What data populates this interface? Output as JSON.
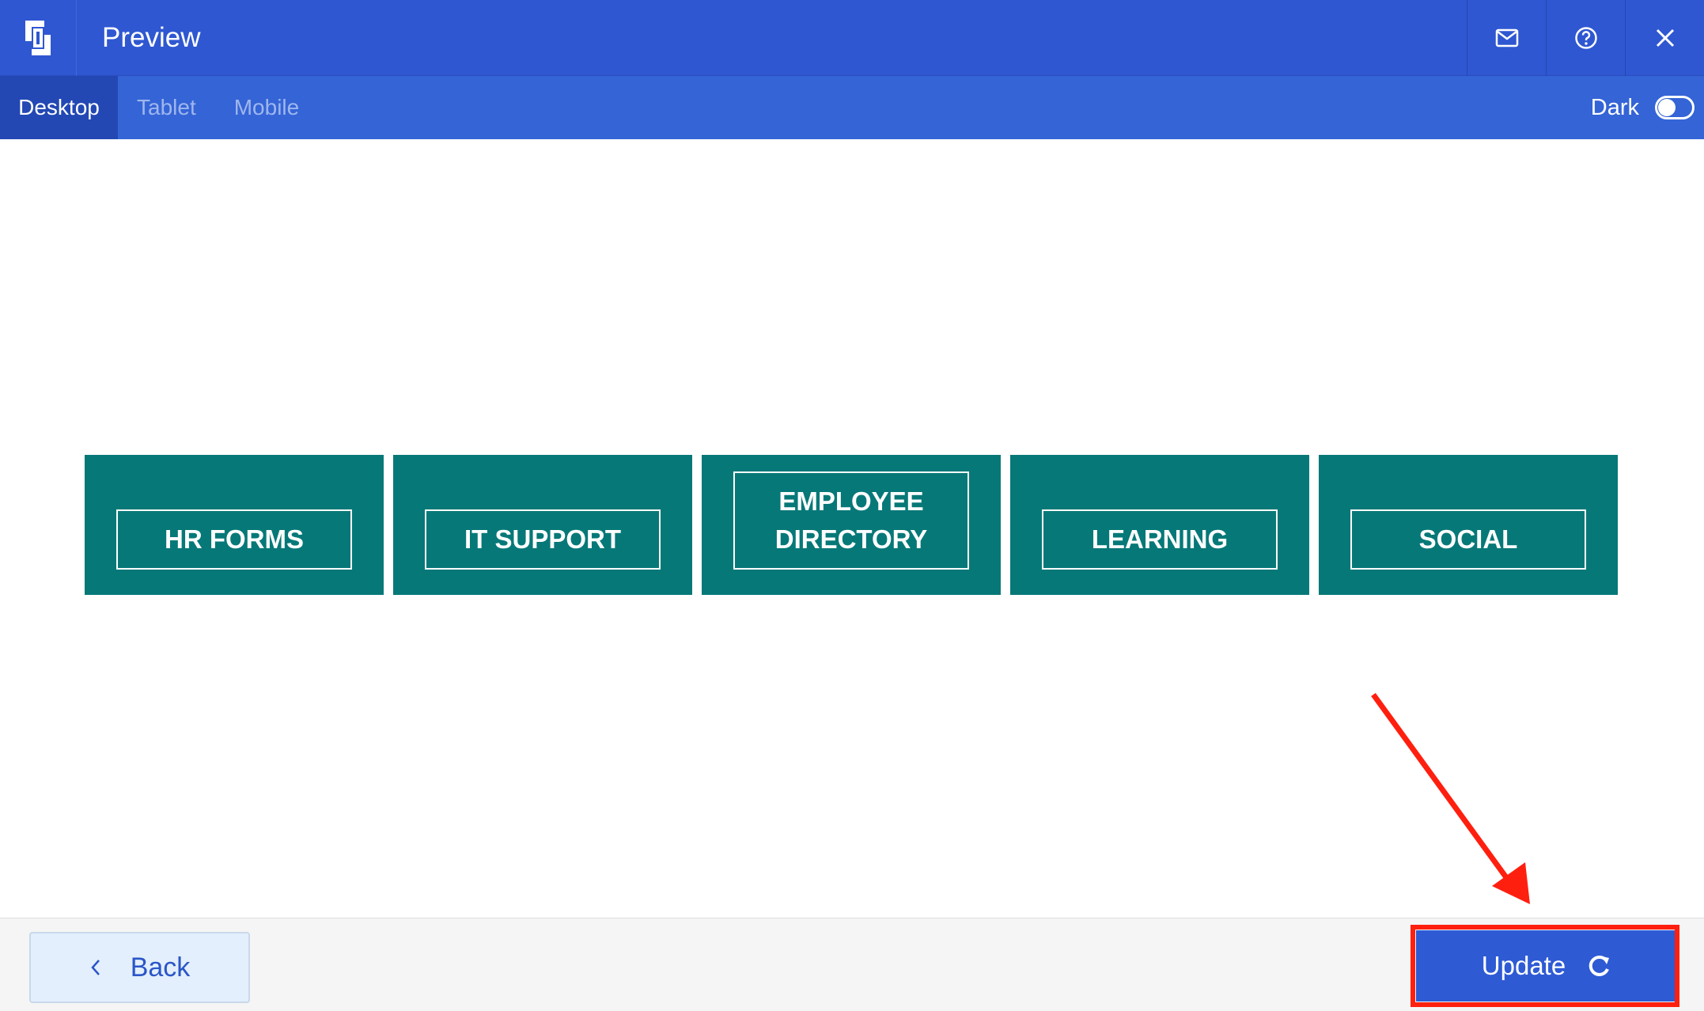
{
  "header": {
    "title": "Preview",
    "logo_icon": "brand-logo-icon",
    "actions": [
      {
        "name": "mail-icon"
      },
      {
        "name": "help-icon"
      },
      {
        "name": "close-icon"
      }
    ],
    "color": "#2f57d1"
  },
  "device_tabs": [
    {
      "label": "Desktop",
      "active": true
    },
    {
      "label": "Tablet",
      "active": false
    },
    {
      "label": "Mobile",
      "active": false
    }
  ],
  "dark_mode": {
    "label": "Dark",
    "enabled": false
  },
  "tiles": [
    {
      "label": "HR FORMS"
    },
    {
      "label": "IT SUPPORT"
    },
    {
      "label": "EMPLOYEE DIRECTORY"
    },
    {
      "label": "LEARNING"
    },
    {
      "label": "SOCIAL"
    }
  ],
  "tile_color": "#077878",
  "footer": {
    "back_label": "Back",
    "update_label": "Update",
    "update_icon": "refresh-icon",
    "back_icon": "chevron-left-icon"
  },
  "annotation": {
    "color": "#ff1f0f",
    "target": "update-button"
  }
}
